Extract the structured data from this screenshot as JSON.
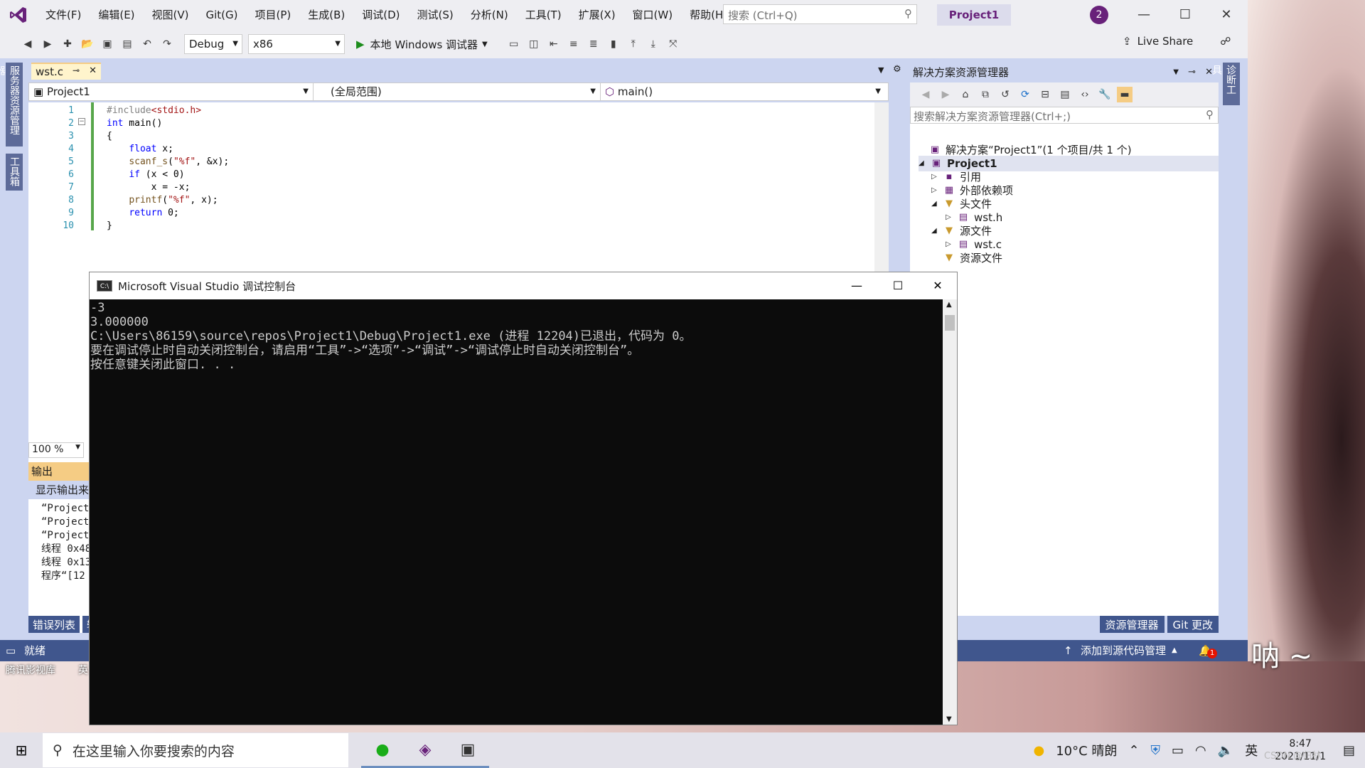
{
  "window": {
    "project_badge": "Project1",
    "notification_count": "2"
  },
  "menu": [
    "文件(F)",
    "编辑(E)",
    "视图(V)",
    "Git(G)",
    "项目(P)",
    "生成(B)",
    "调试(D)",
    "测试(S)",
    "分析(N)",
    "工具(T)",
    "扩展(X)",
    "窗口(W)",
    "帮助(H)"
  ],
  "search": {
    "placeholder": "搜索 (Ctrl+Q)"
  },
  "toolbar": {
    "config": "Debug",
    "platform": "x86",
    "run_label": "本地 Windows 调试器",
    "live_share": "Live Share"
  },
  "left_tabs": [
    "服务器资源管理器",
    "工具箱"
  ],
  "editor": {
    "tab": "wst.c",
    "nav_project": "Project1",
    "nav_scope": "(全局范围)",
    "nav_func": "main()",
    "zoom": "100 %",
    "line_numbers": [
      "1",
      "2",
      "3",
      "4",
      "5",
      "6",
      "7",
      "8",
      "9",
      "10"
    ],
    "code": [
      "#include<stdio.h>",
      "int main()",
      "{",
      "    float x;",
      "    scanf_s(\"%f\", &x);",
      "    if (x < 0)",
      "        x = -x;",
      "    printf(\"%f\", x);",
      "    return 0;",
      "}"
    ]
  },
  "output": {
    "title": "输出",
    "show_from": "显示输出来",
    "lines": [
      "“Project",
      "“Project",
      "“Project",
      "线程 0x48",
      "线程 0x13",
      "程序“[12"
    ],
    "bottom_tabs": [
      "错误列表",
      "输"
    ]
  },
  "solution_explorer": {
    "title": "解决方案资源管理器",
    "search_placeholder": "搜索解决方案资源管理器(Ctrl+;)",
    "items": [
      {
        "label": "解决方案“Project1”(1 个项目/共 1 个)",
        "expander": ""
      },
      {
        "label": "Project1",
        "expander": "◢"
      },
      {
        "label": "引用",
        "expander": "▷"
      },
      {
        "label": "外部依赖项",
        "expander": "▷"
      },
      {
        "label": "头文件",
        "expander": "◢"
      },
      {
        "label": "wst.h",
        "expander": "▷"
      },
      {
        "label": "源文件",
        "expander": "◢"
      },
      {
        "label": "wst.c",
        "expander": "▷"
      },
      {
        "label": "资源文件",
        "expander": ""
      }
    ],
    "bottom_tabs": [
      "资源管理器",
      "Git 更改"
    ]
  },
  "right_tab": "诊断工具",
  "status": {
    "ready": "就绪",
    "source_control": "添加到源代码管理",
    "bell_count": "1"
  },
  "console": {
    "title": "Microsoft Visual Studio 调试控制台",
    "lines": [
      "-3",
      "3.000000",
      "C:\\Users\\86159\\source\\repos\\Project1\\Debug\\Project1.exe (进程 12204)已退出，代码为 0。",
      "要在调试停止时自动关闭控制台，请启用“工具”->“选项”->“调试”->“调试停止时自动关闭控制台”。",
      "按任意键关闭此窗口. . ."
    ]
  },
  "desktop": {
    "wall_text": "呐 ~",
    "icon1": "腾讯影视库",
    "icon2": "英"
  },
  "taskbar": {
    "search_placeholder": "在这里输入你要搜索的内容",
    "weather": "10°C 晴朗",
    "ime": "英",
    "time": "8:47",
    "date": "2021/11/1",
    "watermark": "CSDN @归林"
  },
  "colors": {
    "accent": "#68217a",
    "status_bar": "#40568d",
    "panel": "#ccd5f0",
    "active_tab": "#f5cc84"
  }
}
